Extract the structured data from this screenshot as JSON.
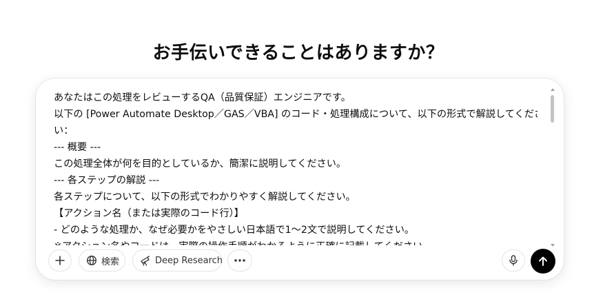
{
  "heading": "お手伝いできることはありますか？",
  "prompt": {
    "lines": [
      "あなたはこの処理をレビューするQA（品質保証）エンジニアです。",
      "以下の [Power Automate Desktop／GAS／VBA] のコード・処理構成について、以下の形式で解説してくださ",
      "い：",
      "--- 概要 ---",
      "この処理全体が何を目的としているか、簡潔に説明してください。",
      "--- 各ステップの解説 ---",
      "各ステップについて、以下の形式でわかりやすく解説してください。",
      "【アクション名（または実際のコード行）】",
      "- どのような処理か、なぜ必要かをやさしい日本語で1～2文で説明してください。",
      "※アクション名やコードは、実際の操作手順がわかるように正確に記載してください。"
    ]
  },
  "toolbar": {
    "plus_icon": "plus-icon",
    "search_label": "検索",
    "search_icon": "globe-icon",
    "research_label": "Deep Research",
    "research_icon": "telescope-icon",
    "more_icon": "ellipsis-icon",
    "mic_icon": "microphone-icon",
    "send_icon": "arrow-up-icon"
  },
  "colors": {
    "send_button": "#000000",
    "border": "#e3e3e3",
    "text": "#0d0d0d"
  }
}
